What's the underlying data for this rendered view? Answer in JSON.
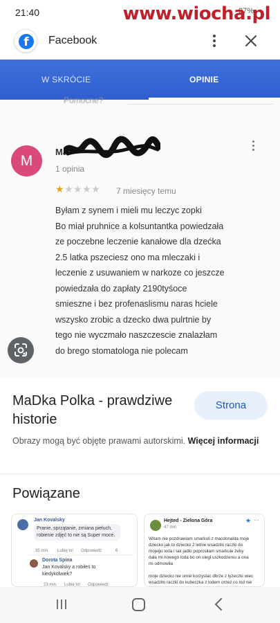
{
  "status_bar": {
    "time": "21:40",
    "battery": "27%"
  },
  "watermark": "www.wiocha.pl",
  "header": {
    "app_title": "Facebook"
  },
  "screenshot": {
    "tabs": [
      "W SKRÓCIE",
      "OPINIE"
    ],
    "active_tab": "OPINIE",
    "helpful_label": "Pomocne?",
    "review": {
      "avatar_letter": "M",
      "name": "Ma",
      "count": "1 opinia",
      "rating": 1,
      "rating_max": 5,
      "date": "7 miesięcy temu",
      "lines": [
        "Byłam z synem i mieli mu leczyc zopki",
        "Bo miał pruhnice a kolsuntantka powiedzała",
        "ze poczebne leczenie kanałowe dla dzećka",
        "2.5  latka pszeciesz ono ma mleczaki i",
        "leczenie z usuwaniem w narkoze co jeszcze",
        "powiedzała do zapłaty 2190tyśoce",
        "smieszne i bez  profenaslismu naras hciele",
        "wszysko zrobic a dzecko dwa pulrtnie by",
        "tego nie wyczmało naszczescie znalazłam",
        "do brego stomatologa nie polecam"
      ]
    }
  },
  "info": {
    "site_title": "MaDka Polka - prawdziwe historie",
    "visit_button": "Strona",
    "copyright_text": "Obrazy mogą być objęte prawami autorskimi.",
    "more_info": "Więcej informacji"
  },
  "related": {
    "title": "Powiązane",
    "cards": [
      {
        "author": "Jan Kovalsky",
        "text": "Pranie, sprzątanie, zmiana pieluch, robienie zdjęć to nie są Super moce.",
        "meta": [
          "35 min.",
          "Lubię to!",
          "Odpowiedz"
        ],
        "reactions": "6",
        "reply_author": "Dorota Spina",
        "reply_text": "Jan Kovalsky a robiłeś to kiedykolwiek?",
        "reply_meta": [
          "23 min.",
          "Lubię to!",
          "Odpowiedz"
        ]
      },
      {
        "author": "Hejted - Zielona Góra",
        "time": "47 min",
        "text_lines": [
          "Witam nie pozdrawiam smarkuli z macdonalda  moje",
          "dziecko jak to dziecko 2 letnie wsadziło raczki do",
          "mojego loda i tak jadło poprosiłam smarkule żeby",
          "dała mi nowego loda bo on uległ uszkodzeniu a ona",
          "mi odmowiła",
          "",
          "moje dziecko nie umie korzystac dbrze z łyzeczki wiec",
          "wsadziło raczki do kubeczka z lodem orzez co lod nie"
        ]
      }
    ]
  }
}
